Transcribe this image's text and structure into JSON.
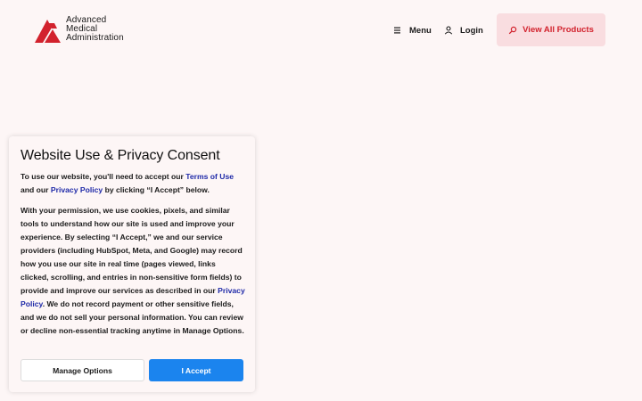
{
  "brand": {
    "line1": "Advanced",
    "line2": "Medical",
    "line3": "Administration",
    "color": "#d2222d"
  },
  "nav": {
    "menu_label": "Menu",
    "menu_icon": "hamburger-icon",
    "login_label": "Login",
    "login_icon": "user-icon",
    "cta_label": "View All Products",
    "cta_icon": "search-icon"
  },
  "consent": {
    "title": "Website Use & Privacy Consent",
    "p1_a": "To use our website, you'll need to accept our ",
    "p1_terms": "Terms of Use",
    "p1_b": " and our ",
    "p1_privacy": "Privacy Policy",
    "p1_c": " by clicking “I Accept” below.",
    "p2_a": "With your permission, we use cookies, pixels, and similar tools to understand how our site is used and improve your experience. By selecting “I Accept,” we and our service providers (including HubSpot, Meta, and Google) may record how you use our site in real time (pages viewed, links clicked, scrolling, and entries in non-sensitive form fields) to provide and improve our services as described in our ",
    "p2_privacy": "Privacy Policy",
    "p2_b": ". We do not record payment or other sensitive fields, and we do not sell your personal information. You can review or decline non-essential tracking anytime in Manage Options.",
    "manage_label": "Manage Options",
    "accept_label": "I Accept",
    "accept_color": "#1b84ee",
    "link_color": "#1f2aa8"
  }
}
